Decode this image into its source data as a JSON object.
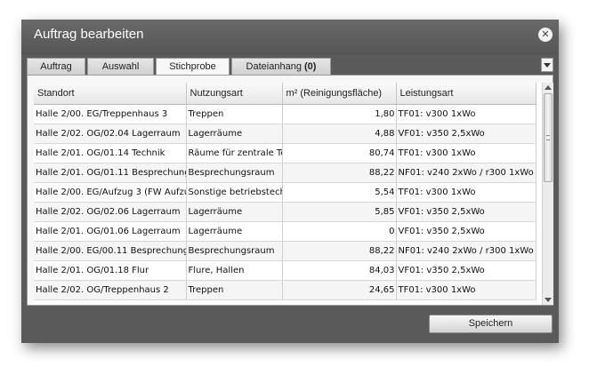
{
  "dialog": {
    "title": "Auftrag bearbeiten",
    "close_icon": "close-icon"
  },
  "tabs": [
    {
      "label": "Auftrag",
      "active": false
    },
    {
      "label": "Auswahl",
      "active": false
    },
    {
      "label": "Stichprobe",
      "active": true
    },
    {
      "label": "Dateianhang",
      "badge": "(0)",
      "active": false
    }
  ],
  "table": {
    "columns": [
      "Standort",
      "Nutzungsart",
      "m² (Reinigungsfläche)",
      "Leistungsart"
    ],
    "rows": [
      [
        "Halle 2/00. EG/Treppenhaus 3",
        "Treppen",
        "1,80",
        "TF01: v300 1xWo"
      ],
      [
        "Halle 2/02. OG/02.04 Lagerraum",
        "Lagerräume",
        "4,88",
        "VF01: v350 2,5xWo"
      ],
      [
        "Halle 2/01. OG/01.14 Technik",
        "Räume für zentrale Te",
        "80,74",
        "TF01: v300 1xWo"
      ],
      [
        "Halle 2/01. OG/01.11 Besprechung",
        "Besprechungsraum",
        "88,22",
        "NF01: v240 2xWo / r300 1xWo"
      ],
      [
        "Halle 2/00. EG/Aufzug 3 (FW Aufzu",
        "Sonstige betriebstech",
        "5,54",
        "TF01: v300 1xWo"
      ],
      [
        "Halle 2/02. OG/02.06 Lagerraum",
        "Lagerräume",
        "5,85",
        "VF01: v350 2,5xWo"
      ],
      [
        "Halle 2/01. OG/01.06 Lagerraum",
        "Lagerräume",
        "0",
        "VF01: v350 2,5xWo"
      ],
      [
        "Halle 2/00. EG/00.11 Besprechung",
        "Besprechungsraum",
        "88,22",
        "NF01: v240 2xWo / r300 1xWo"
      ],
      [
        "Halle 2/01. OG/01.18 Flur",
        "Flure, Hallen",
        "84,03",
        "VF01: v350 2,5xWo"
      ],
      [
        "Halle 2/02. OG/Treppenhaus 2",
        "Treppen",
        "24,65",
        "TF01: v300 1xWo"
      ]
    ]
  },
  "footer": {
    "save_label": "Speichern"
  },
  "colors": {
    "dialog_bg": "#5a5a5a",
    "title_text": "#ffffff",
    "panel_bg": "#f7f7f7"
  }
}
